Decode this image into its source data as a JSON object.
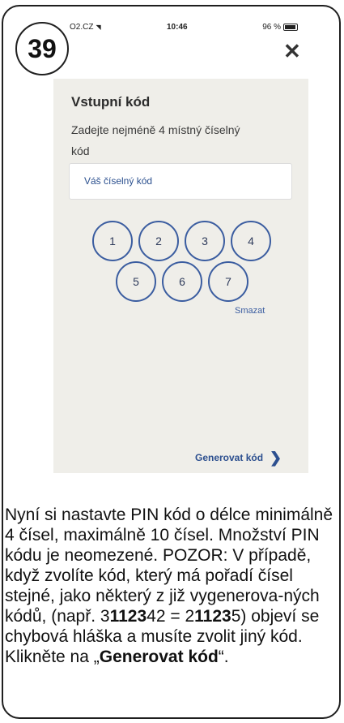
{
  "step_number": "39",
  "status_bar": {
    "carrier": "O2.CZ",
    "time": "10:46",
    "battery": "96 %"
  },
  "screen": {
    "title": "Vstupní kód",
    "subtitle": "Zadejte nejméně 4 místný číselný kód",
    "input_placeholder": "Váš číselný kód",
    "keypad": [
      "1",
      "2",
      "3",
      "4",
      "5",
      "6",
      "7"
    ],
    "clear_label": "Smazat",
    "generate_label": "Generovat kód"
  },
  "instructions": {
    "line1": "Nyní si nastavte PIN kód o délce minimálně 4 čísel, maximálně 10 čísel. Množství PIN kódu je neomezené. POZOR: V případě, když zvolíte kód, který má pořadí čísel stejné, jako některý z již vygenerova-ných kódů, (např. 3",
    "example1_bold": "1123",
    "mid1": "42 = 2",
    "example2_bold": "1123",
    "line1_end": "5) objeví se chybová hláška a musíte zvolit jiný kód.",
    "click_prefix": "Klikněte na „",
    "click_bold": "Generovat kód",
    "click_suffix": "“."
  }
}
